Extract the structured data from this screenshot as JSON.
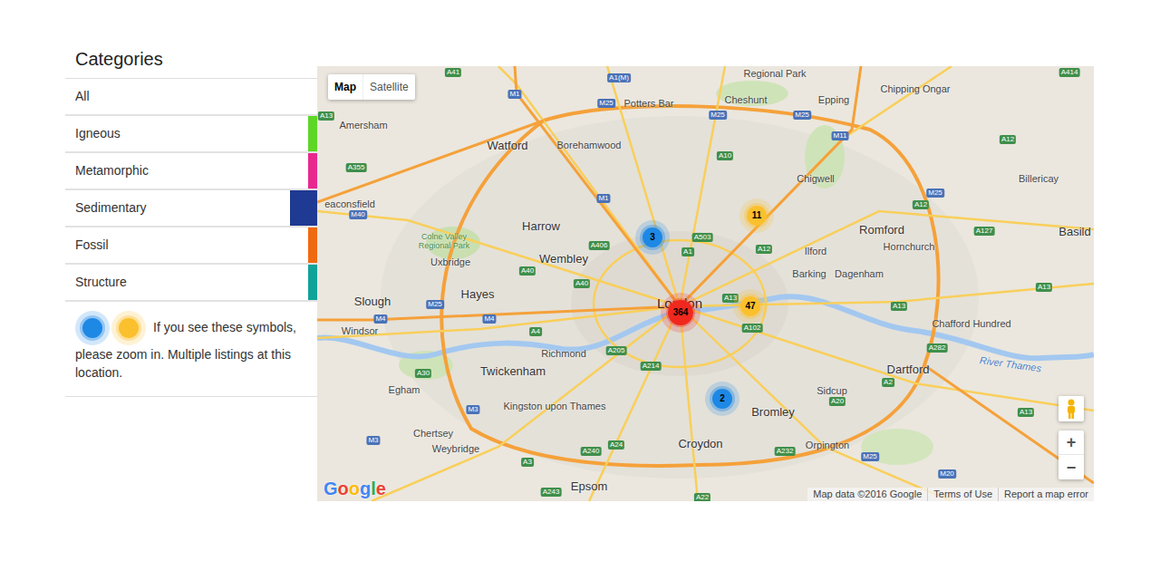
{
  "sidebar": {
    "title": "Categories",
    "items": [
      {
        "label": "All",
        "selected": false
      },
      {
        "label": "Igneous",
        "selected": false,
        "color": "#5ed626"
      },
      {
        "label": "Metamorphic",
        "selected": false,
        "color": "#e8288f"
      },
      {
        "label": "Sedimentary",
        "selected": true,
        "color": "#1f3a93"
      },
      {
        "label": "Fossil",
        "selected": false,
        "color": "#f06a10"
      },
      {
        "label": "Structure",
        "selected": false,
        "color": "#10a39a"
      }
    ]
  },
  "legend": {
    "symbols": [
      {
        "color": "#1e88e5"
      },
      {
        "color": "#fbc02d"
      }
    ],
    "text": "If you see these symbols, please zoom in. Multiple listings at this location."
  },
  "map": {
    "type_controls": [
      {
        "label": "Map",
        "selected": true
      },
      {
        "label": "Satellite",
        "selected": false
      }
    ],
    "clusters": [
      {
        "count": "3",
        "color": "#1e88e5"
      },
      {
        "count": "11",
        "color": "#fbc02d"
      },
      {
        "count": "364",
        "color": "#f0281e"
      },
      {
        "count": "47",
        "color": "#fbc02d"
      },
      {
        "count": "2",
        "color": "#1e88e5"
      }
    ],
    "places": [
      {
        "label": "Regional Park",
        "kind": "town"
      },
      {
        "label": "Chipping Ongar",
        "kind": "town"
      },
      {
        "label": "Potters Bar",
        "kind": "town"
      },
      {
        "label": "Cheshunt",
        "kind": "town"
      },
      {
        "label": "Epping",
        "kind": "town"
      },
      {
        "label": "Amersham",
        "kind": "town"
      },
      {
        "label": "Watford",
        "kind": "city"
      },
      {
        "label": "Borehamwood",
        "kind": "town"
      },
      {
        "label": "Chigwell",
        "kind": "town"
      },
      {
        "label": "Billericay",
        "kind": "town"
      },
      {
        "label": "eaconsfield",
        "kind": "town"
      },
      {
        "label": "Harrow",
        "kind": "city"
      },
      {
        "label": "Colne Valley Regional Park",
        "kind": "park"
      },
      {
        "label": "Romford",
        "kind": "city"
      },
      {
        "label": "Hornchurch",
        "kind": "town"
      },
      {
        "label": "Basild",
        "kind": "city"
      },
      {
        "label": "Wembley",
        "kind": "city"
      },
      {
        "label": "Uxbridge",
        "kind": "town"
      },
      {
        "label": "Ilford",
        "kind": "town"
      },
      {
        "label": "Barking",
        "kind": "town"
      },
      {
        "label": "Dagenham",
        "kind": "town"
      },
      {
        "label": "Slough",
        "kind": "city"
      },
      {
        "label": "Hayes",
        "kind": "city"
      },
      {
        "label": "London",
        "kind": "capital"
      },
      {
        "label": "Windsor",
        "kind": "town"
      },
      {
        "label": "Richmond",
        "kind": "town"
      },
      {
        "label": "Twickenham",
        "kind": "city"
      },
      {
        "label": "Chafford Hundred",
        "kind": "town"
      },
      {
        "label": "Dartford",
        "kind": "city"
      },
      {
        "label": "River Thames",
        "kind": "river"
      },
      {
        "label": "Egham",
        "kind": "town"
      },
      {
        "label": "Kingston upon Thames",
        "kind": "town"
      },
      {
        "label": "Sidcup",
        "kind": "town"
      },
      {
        "label": "Bromley",
        "kind": "city"
      },
      {
        "label": "Chertsey",
        "kind": "town"
      },
      {
        "label": "Weybridge",
        "kind": "town"
      },
      {
        "label": "Croydon",
        "kind": "city"
      },
      {
        "label": "Orpington",
        "kind": "town"
      },
      {
        "label": "Epsom",
        "kind": "city"
      }
    ],
    "roads": [
      {
        "label": "A41",
        "kind": "a-road"
      },
      {
        "label": "A1(M)",
        "kind": "motorway"
      },
      {
        "label": "A414",
        "kind": "a-road"
      },
      {
        "label": "M1",
        "kind": "motorway"
      },
      {
        "label": "M25",
        "kind": "motorway"
      },
      {
        "label": "M25",
        "kind": "motorway"
      },
      {
        "label": "M25",
        "kind": "motorway"
      },
      {
        "label": "M11",
        "kind": "motorway"
      },
      {
        "label": "A12",
        "kind": "a-road"
      },
      {
        "label": "A13",
        "kind": "a-road"
      },
      {
        "label": "A10",
        "kind": "a-road"
      },
      {
        "label": "A355",
        "kind": "a-road"
      },
      {
        "label": "M40",
        "kind": "motorway"
      },
      {
        "label": "M1",
        "kind": "motorway"
      },
      {
        "label": "M25",
        "kind": "motorway"
      },
      {
        "label": "A12",
        "kind": "a-road"
      },
      {
        "label": "A406",
        "kind": "a-road"
      },
      {
        "label": "A503",
        "kind": "a-road"
      },
      {
        "label": "A1",
        "kind": "a-road"
      },
      {
        "label": "A12",
        "kind": "a-road"
      },
      {
        "label": "A127",
        "kind": "a-road"
      },
      {
        "label": "A13",
        "kind": "a-road"
      },
      {
        "label": "A40",
        "kind": "a-road"
      },
      {
        "label": "A40",
        "kind": "a-road"
      },
      {
        "label": "A13",
        "kind": "a-road"
      },
      {
        "label": "M25",
        "kind": "motorway"
      },
      {
        "label": "M4",
        "kind": "motorway"
      },
      {
        "label": "M4",
        "kind": "motorway"
      },
      {
        "label": "A4",
        "kind": "a-road"
      },
      {
        "label": "A13",
        "kind": "a-road"
      },
      {
        "label": "A102",
        "kind": "a-road"
      },
      {
        "label": "A282",
        "kind": "a-road"
      },
      {
        "label": "A205",
        "kind": "a-road"
      },
      {
        "label": "A214",
        "kind": "a-road"
      },
      {
        "label": "A30",
        "kind": "a-road"
      },
      {
        "label": "M3",
        "kind": "motorway"
      },
      {
        "label": "A20",
        "kind": "a-road"
      },
      {
        "label": "A2",
        "kind": "a-road"
      },
      {
        "label": "A13",
        "kind": "a-road"
      },
      {
        "label": "A3",
        "kind": "a-road"
      },
      {
        "label": "A24",
        "kind": "a-road"
      },
      {
        "label": "A240",
        "kind": "a-road"
      },
      {
        "label": "A232",
        "kind": "a-road"
      },
      {
        "label": "M25",
        "kind": "motorway"
      },
      {
        "label": "M3",
        "kind": "motorway"
      },
      {
        "label": "A243",
        "kind": "a-road"
      },
      {
        "label": "A22",
        "kind": "a-road"
      },
      {
        "label": "M20",
        "kind": "motorway"
      }
    ],
    "zoom_controls": [
      "+",
      "−"
    ],
    "logo": "Google",
    "attribution": [
      "Map data ©2016 Google",
      "Terms of Use",
      "Report a map error"
    ]
  }
}
